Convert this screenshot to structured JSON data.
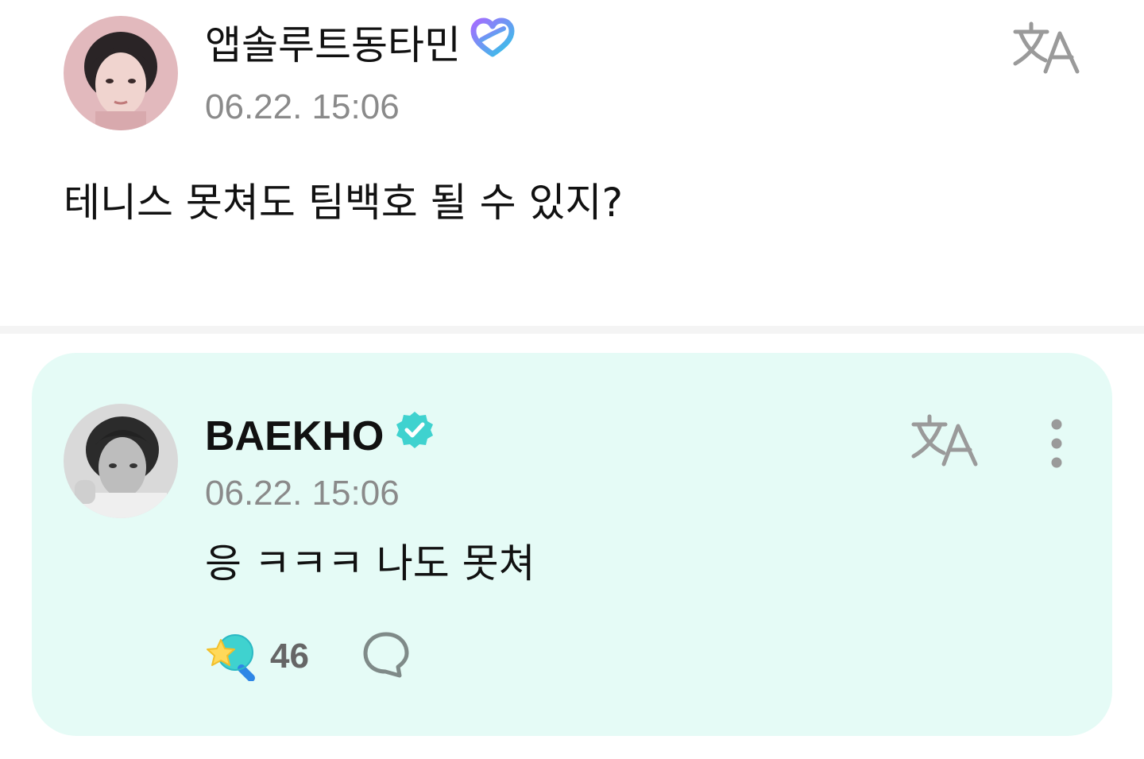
{
  "post": {
    "author": "앱솔루트동타민",
    "author_badge_icon": "heart-badge-icon",
    "timestamp": "06.22. 15:06",
    "body": "테니스 못쳐도 팀백호 될 수 있지?",
    "translate_icon": "translate-icon"
  },
  "comment": {
    "author": "BAEKHO",
    "author_badge_icon": "verified-badge-icon",
    "timestamp": "06.22. 15:06",
    "body": "응 ㅋㅋㅋ 나도 못쳐",
    "translate_icon": "translate-icon",
    "more_icon": "more-vertical-icon",
    "like_icon": "star-lightstick-icon",
    "like_count": "46",
    "reply_icon": "speech-bubble-icon"
  },
  "colors": {
    "card_background": "#e5fbf6",
    "verified_badge": "#3fd2cf",
    "heart_badge_start": "#a56bff",
    "heart_badge_end": "#2ec8e6",
    "timestamp_text": "#8a8a8a",
    "icon_gray": "#9a9a9a"
  }
}
